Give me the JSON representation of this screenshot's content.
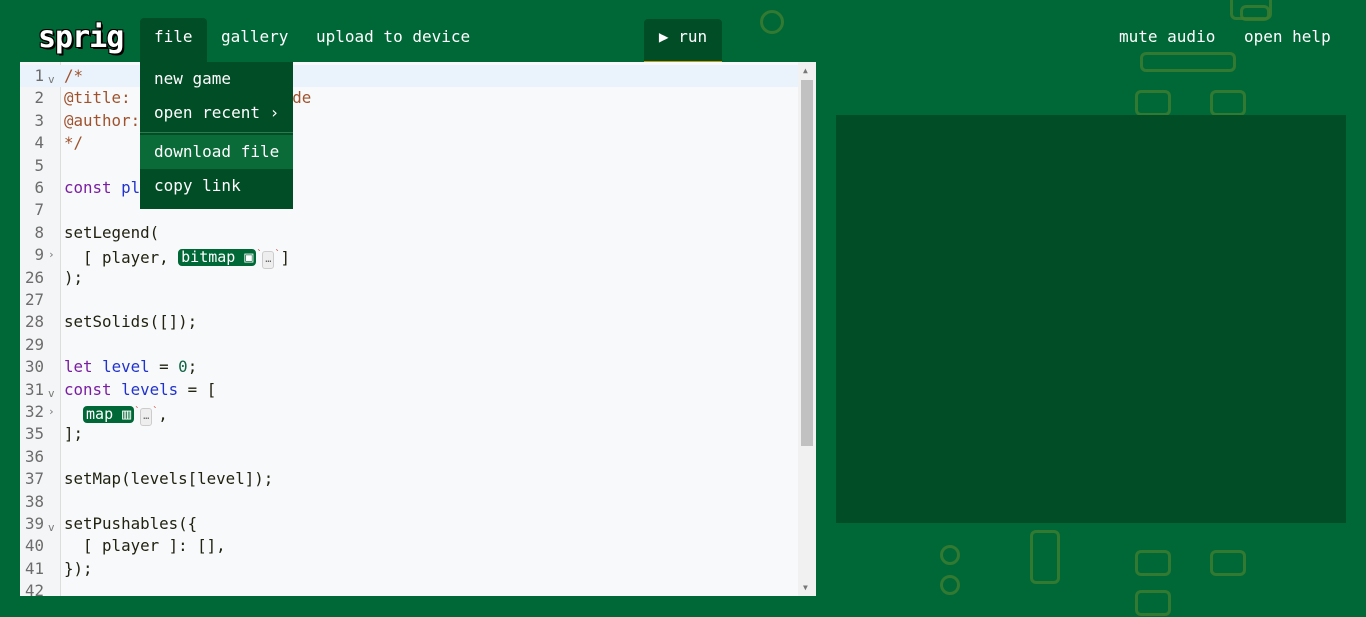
{
  "header": {
    "logo": "sprig",
    "nav": [
      {
        "label": "file",
        "active": true
      },
      {
        "label": "gallery"
      },
      {
        "label": "upload to device"
      }
    ],
    "run_label": "run",
    "run_icon": "play-icon",
    "right": [
      {
        "label": "mute audio"
      },
      {
        "label": "open help"
      }
    ]
  },
  "file_menu": {
    "items": [
      {
        "label": "new game"
      },
      {
        "label": "open recent ›"
      },
      {
        "label": "download file",
        "hovered": true
      },
      {
        "label": "copy link"
      }
    ]
  },
  "colors": {
    "background": "#006837",
    "panel": "#004d26",
    "run_accent": "#c89a08",
    "pill": "#006837"
  },
  "editor": {
    "lines": [
      {
        "n": "1",
        "fold": "v",
        "tokens": [
          {
            "t": "/*",
            "c": "c-meta"
          }
        ]
      },
      {
        "n": "2",
        "tokens": [
          {
            "t": "@title:                 de",
            "c": "c-meta"
          }
        ]
      },
      {
        "n": "3",
        "tokens": [
          {
            "t": "@author:",
            "c": "c-meta"
          }
        ]
      },
      {
        "n": "4",
        "tokens": [
          {
            "t": "*/",
            "c": "c-meta"
          }
        ]
      },
      {
        "n": "5",
        "tokens": []
      },
      {
        "n": "6",
        "tokens": [
          {
            "t": "const",
            "c": "c-kw"
          },
          {
            "t": " "
          },
          {
            "t": "pl",
            "c": "c-var"
          }
        ]
      },
      {
        "n": "7",
        "tokens": []
      },
      {
        "n": "8",
        "tokens": [
          {
            "t": "setLegend("
          }
        ]
      },
      {
        "n": "9",
        "fold": "›",
        "tokens": [
          {
            "t": "  [ player, "
          },
          {
            "t": "bitmap ▣",
            "c": "pill"
          },
          {
            "t": "`",
            "c": "tick"
          },
          {
            "t": "…",
            "c": "dots"
          },
          {
            "t": "`",
            "c": "tick"
          },
          {
            "t": "]"
          }
        ]
      },
      {
        "n": "26",
        "tokens": [
          {
            "t": ");"
          }
        ]
      },
      {
        "n": "27",
        "tokens": []
      },
      {
        "n": "28",
        "tokens": [
          {
            "t": "setSolids([]);"
          }
        ]
      },
      {
        "n": "29",
        "tokens": []
      },
      {
        "n": "30",
        "tokens": [
          {
            "t": "let",
            "c": "c-kw"
          },
          {
            "t": " "
          },
          {
            "t": "level",
            "c": "c-var"
          },
          {
            "t": " = "
          },
          {
            "t": "0",
            "c": "c-num"
          },
          {
            "t": ";"
          }
        ]
      },
      {
        "n": "31",
        "fold": "v",
        "tokens": [
          {
            "t": "const",
            "c": "c-kw"
          },
          {
            "t": " "
          },
          {
            "t": "levels",
            "c": "c-var"
          },
          {
            "t": " = ["
          }
        ]
      },
      {
        "n": "32",
        "fold": "›",
        "tokens": [
          {
            "t": "  "
          },
          {
            "t": "map ▥",
            "c": "pill"
          },
          {
            "t": "`",
            "c": "tick"
          },
          {
            "t": "…",
            "c": "dots"
          },
          {
            "t": "`",
            "c": "tick"
          },
          {
            "t": ","
          }
        ]
      },
      {
        "n": "35",
        "tokens": [
          {
            "t": "];"
          }
        ]
      },
      {
        "n": "36",
        "tokens": []
      },
      {
        "n": "37",
        "tokens": [
          {
            "t": "setMap(levels[level]);"
          }
        ]
      },
      {
        "n": "38",
        "tokens": []
      },
      {
        "n": "39",
        "fold": "v",
        "tokens": [
          {
            "t": "setPushables({"
          }
        ]
      },
      {
        "n": "40",
        "tokens": [
          {
            "t": "  [ player ]: [],"
          }
        ]
      },
      {
        "n": "41",
        "tokens": [
          {
            "t": "});"
          }
        ]
      },
      {
        "n": "42",
        "tokens": []
      }
    ]
  }
}
